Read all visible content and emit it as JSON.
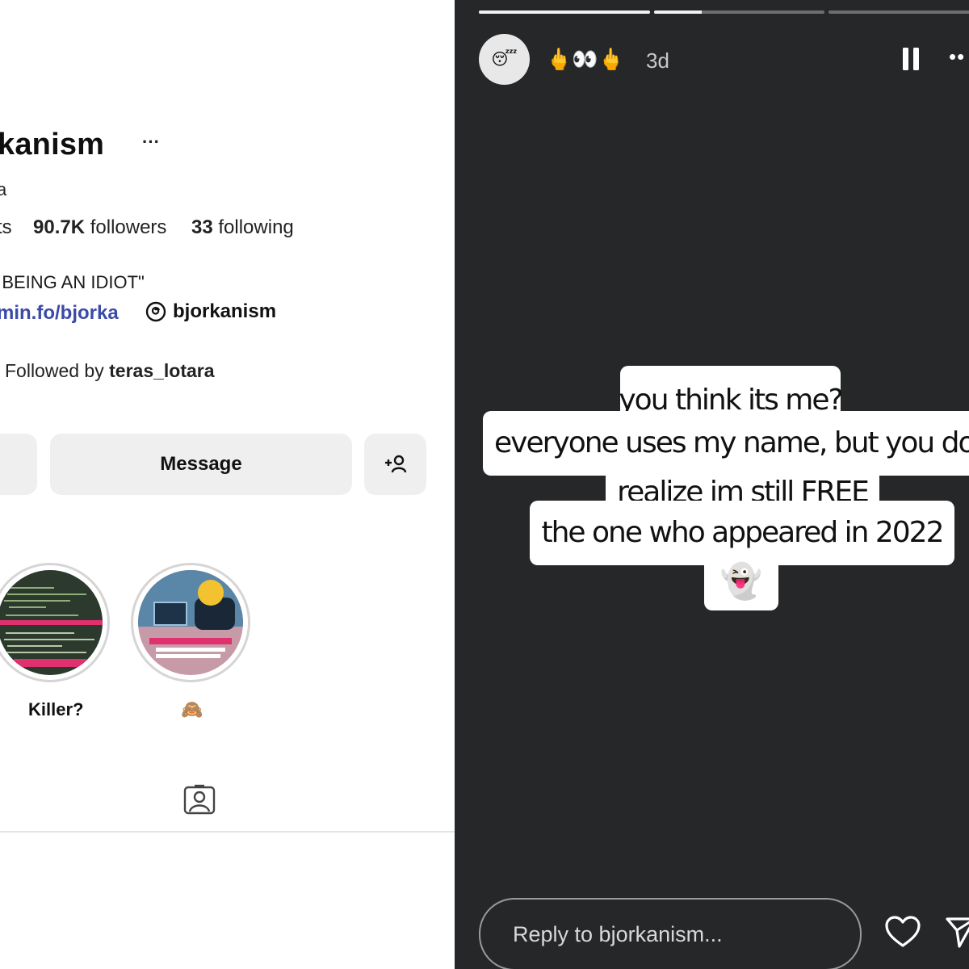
{
  "profile": {
    "username": "rkanism",
    "more_label": "···",
    "name_fragment": "a",
    "stats": {
      "posts_fragment": "ts",
      "followers_count": "90.7K",
      "followers_label": "followers",
      "following_count": "33",
      "following_label": "following"
    },
    "bio": "' BEING AN IDIOT\"",
    "link": "min.fo/bjorka",
    "threads_handle": "bjorkanism",
    "followed_by_prefix": "Followed by",
    "followed_by_user": "teras_lotara",
    "message_button": "Message",
    "add_user_label": "+",
    "highlights": [
      {
        "label": "Killer?"
      },
      {
        "label": "🙈"
      }
    ],
    "tagged_tab_icon": "tagged-person-icon"
  },
  "story": {
    "progress": [
      1.0,
      0.28,
      0.0
    ],
    "avatar_emoji": "😴",
    "user_emojis": "🖕👀🖕",
    "time": "3d",
    "more_label": "••",
    "caption_lines": [
      "you think its me?",
      "everyone uses my name, but you don",
      "realize im still FREE",
      "the one who appeared in 2022",
      "👻"
    ],
    "reply_placeholder": "Reply to bjorkanism...",
    "colors": {
      "background": "#262729",
      "text_box": "#ffffff",
      "link_blue": "#3b4aa8"
    }
  }
}
